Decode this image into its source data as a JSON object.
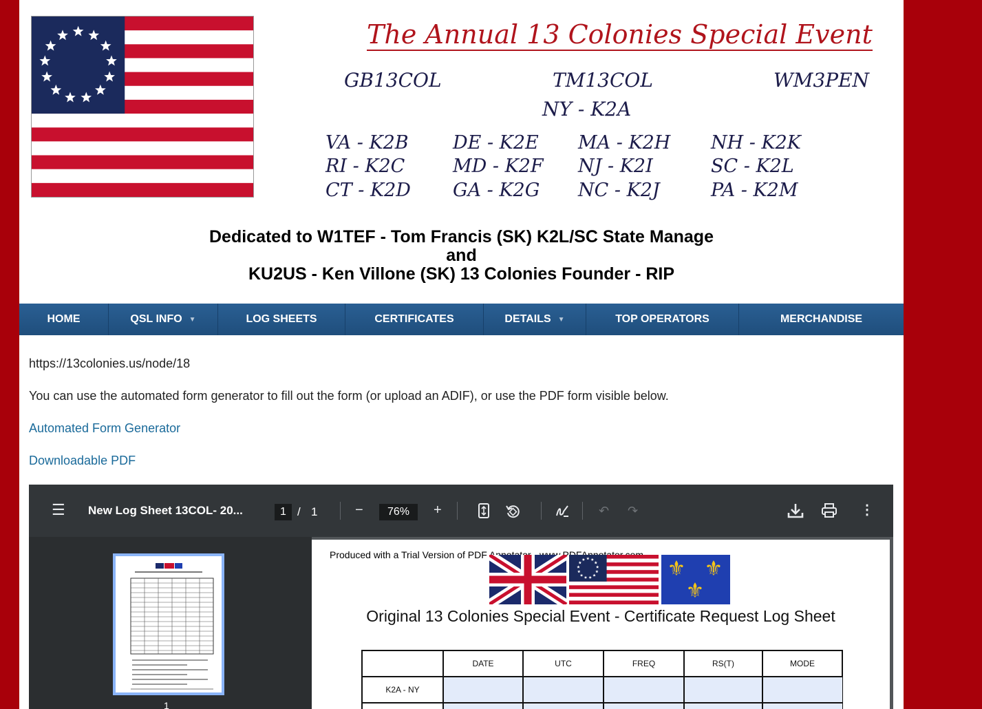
{
  "banner": {
    "title": "The Annual 13 Colonies Special Event",
    "bonus_calls": [
      "GB13COL",
      "TM13COL",
      "WM3PEN"
    ],
    "ny_call": "NY - K2A",
    "state_calls": [
      "VA - K2B",
      "DE - K2E",
      "MA - K2H",
      "NH - K2K",
      "RI - K2C",
      "MD - K2F",
      "NJ - K2I",
      "SC - K2L",
      "CT - K2D",
      "GA - K2G",
      "NC - K2J",
      "PA - K2M"
    ],
    "dedication": {
      "line1": "Dedicated to W1TEF - Tom Francis (SK)  K2L/SC State Manage",
      "line2": "and",
      "line3": "KU2US - Ken Villone (SK) 13 Colonies Founder  -  RIP"
    }
  },
  "nav": {
    "items": [
      {
        "label": "HOME",
        "dropdown": false
      },
      {
        "label": "QSL INFO",
        "dropdown": true
      },
      {
        "label": "LOG SHEETS",
        "dropdown": false
      },
      {
        "label": "CERTIFICATES",
        "dropdown": false
      },
      {
        "label": "DETAILS",
        "dropdown": true
      },
      {
        "label": "TOP OPERATORS",
        "dropdown": false
      },
      {
        "label": "MERCHANDISE",
        "dropdown": false
      }
    ],
    "colors": {
      "bar": "#1f4e7c",
      "text": "#ffffff"
    }
  },
  "content": {
    "url_text": "https://13colonies.us/node/18",
    "intro": "You can use the automated form generator to fill out the form (or upload an ADIF), or use the PDF form visible below.",
    "link_form_generator": "Automated Form Generator",
    "link_pdf": "Downloadable PDF"
  },
  "pdf_viewer": {
    "file_title": "New Log Sheet 13COL- 20...",
    "page_current": "1",
    "page_sep": "/",
    "page_total": "1",
    "zoom": "76%",
    "zoom_out": "−",
    "zoom_in": "+",
    "thumb_label": "1",
    "icons": [
      "menu-icon",
      "fit-page-icon",
      "rotate-icon",
      "annotate-icon",
      "undo-icon",
      "redo-icon",
      "download-icon",
      "print-icon",
      "more-icon"
    ],
    "document": {
      "watermark": "Produced with a Trial Version of PDF Annotator - www.PDFAnnotator.com",
      "title": "Original 13 Colonies Special Event - Certificate Request Log Sheet",
      "columns": [
        "",
        "DATE",
        "UTC",
        "FREQ",
        "RS(T)",
        "MODE"
      ],
      "rows": [
        {
          "station": "K2A - NY"
        },
        {
          "station": ""
        }
      ]
    }
  },
  "colors": {
    "frame": "#a8000a",
    "link": "#1a6a9a",
    "title_red": "#b0141c",
    "script_navy": "#1c1c4a"
  }
}
